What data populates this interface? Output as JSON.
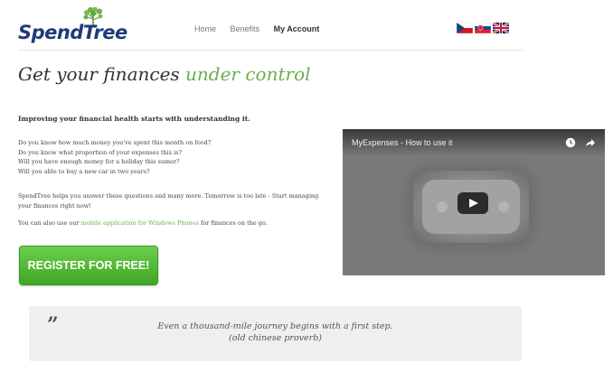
{
  "logo": {
    "text_part1": "Spend",
    "text_part2": "Tree"
  },
  "nav": {
    "items": [
      "Home",
      "Benefits",
      "My Account"
    ]
  },
  "flags": [
    "czech-flag",
    "slovak-flag",
    "uk-flag"
  ],
  "headline": {
    "part1": "Get your finances ",
    "part2": "under control"
  },
  "intro": {
    "bold": "Improving your financial health starts with understanding it.",
    "questions": [
      "Do you know how much money you've spent this month on food?",
      "Do you know what proportion of your expenses this is?",
      "Will you have enough money for a holiday this sumer?",
      "Will you able to buy a new car in two years?"
    ],
    "para2": "SpendTree helps you answer these questions and many more. Tomorrow is too late - Start managing your finances right now!",
    "para3_before": "You can also use our ",
    "para3_link": "mobile application for Windows Phones",
    "para3_after": " for finances on the go."
  },
  "register": {
    "label": "REGISTER FOR FREE!"
  },
  "video": {
    "title": "MyExpenses - How to use it"
  },
  "quote": {
    "mark": "”",
    "line1": "Even a thousand-mile journey begins with a first step.",
    "line2": "(old chinese proverb)"
  },
  "colors": {
    "accent_green": "#6ab04c",
    "logo_blue": "#1e3a7a",
    "button_green": "#4cb832"
  }
}
